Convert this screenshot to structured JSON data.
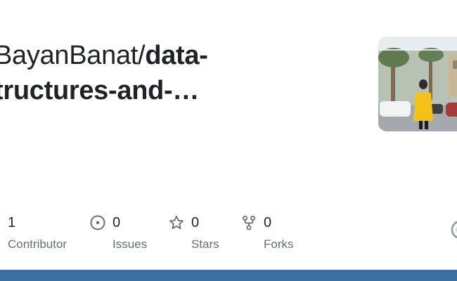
{
  "repo": {
    "owner": "BayanBanat/",
    "name_line1": "data-",
    "name_line2": "tructures-and-…"
  },
  "stats": {
    "contributors": {
      "value": "1",
      "label": "Contributor",
      "icon": "people-icon"
    },
    "issues": {
      "value": "0",
      "label": "Issues",
      "icon": "issue-opened-icon"
    },
    "stars": {
      "value": "0",
      "label": "Stars",
      "icon": "star-icon"
    },
    "forks": {
      "value": "0",
      "label": "Forks",
      "icon": "repo-forked-icon"
    }
  },
  "colors": {
    "text": "#1f2328",
    "muted": "#656d76",
    "bottom_bar": "#3a6ea5"
  }
}
